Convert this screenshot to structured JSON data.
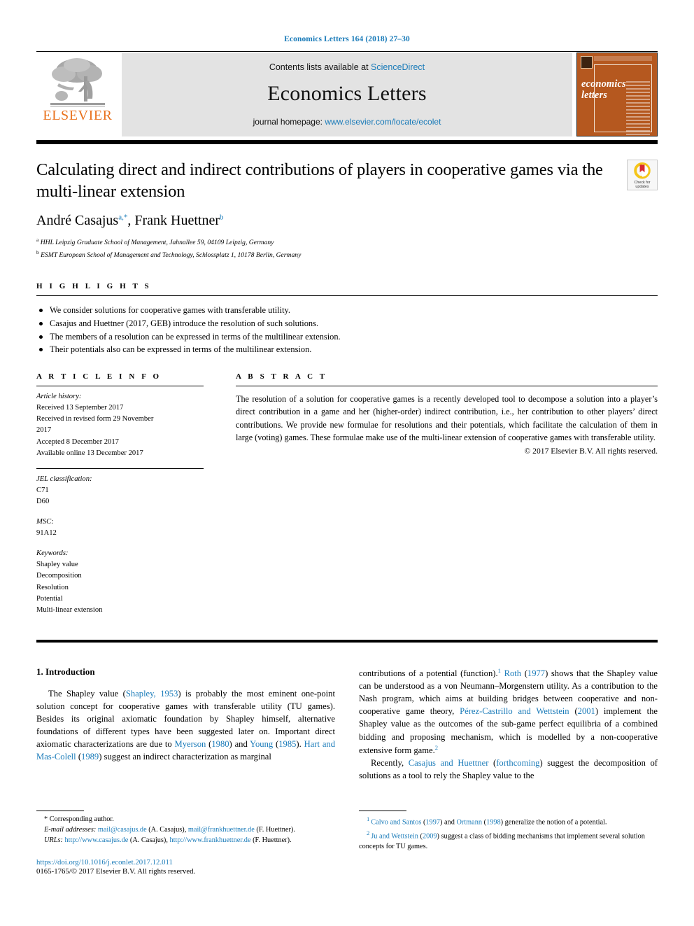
{
  "running_head": "Economics Letters 164 (2018) 27–30",
  "masthead": {
    "publisher_name": "ELSEVIER",
    "contents_prefix": "Contents lists available at ",
    "contents_link": "ScienceDirect",
    "journal_title": "Economics Letters",
    "homepage_prefix": "journal homepage: ",
    "homepage_link": "www.elsevier.com/locate/ecolet",
    "cover_title_line1": "economics",
    "cover_title_line2": "letters"
  },
  "article": {
    "title": "Calculating direct and indirect contributions of players in cooperative games via the multi-linear extension",
    "authors_plain": "André Casajus",
    "author1": "André Casajus",
    "author1_sup": "a,*",
    "author2": "Frank Huettner",
    "author2_sup": "b",
    "affiliation_a_marker": "a",
    "affiliation_a": "HHL Leipzig Graduate School of Management, Jahnallee 59, 04109 Leipzig, Germany",
    "affiliation_b_marker": "b",
    "affiliation_b": "ESMT European School of Management and Technology, Schlossplatz 1, 10178 Berlin, Germany"
  },
  "crossmark": {
    "line1": "Check for",
    "line2": "updates"
  },
  "highlights": {
    "heading": "H I G H L I G H T S",
    "items": [
      "We consider solutions for cooperative games with transferable utility.",
      "Casajus and Huettner (2017, GEB) introduce the resolution of such solutions.",
      "The members of a resolution can be expressed in terms of the multilinear extension.",
      "Their potentials also can be expressed in terms of the multilinear extension."
    ]
  },
  "article_info": {
    "heading": "A R T I C L E   I N F O",
    "history_label": "Article history:",
    "history_lines": [
      "Received 13 September 2017",
      "Received in revised form 29 November",
      "2017",
      "Accepted 8 December 2017",
      "Available online 13 December 2017"
    ],
    "jel_label": "JEL classification:",
    "jel_codes": [
      "C71",
      "D60"
    ],
    "msc_label": "MSC:",
    "msc_codes": [
      "91A12"
    ],
    "keywords_label": "Keywords:",
    "keywords": [
      "Shapley value",
      "Decomposition",
      "Resolution",
      "Potential",
      "Multi-linear extension"
    ]
  },
  "abstract": {
    "heading": "A B S T R A C T",
    "text": "The resolution of a solution for cooperative games is a recently developed tool to decompose a solution into a player’s direct contribution in a game and her (higher-order) indirect contribution, i.e., her contribution to other players’ direct contributions. We provide new formulae for resolutions and their potentials, which facilitate the calculation of them in large (voting) games. These formulae make use of the multi-linear extension of cooperative games with transferable utility.",
    "copyright": "© 2017 Elsevier B.V. All rights reserved."
  },
  "body": {
    "section_number_title": "1. Introduction",
    "left_para1_part1": "The Shapley value (",
    "left_cite1": "Shapley, 1953",
    "left_para1_part2": ") is probably the most eminent one-point solution concept for cooperative games with transferable utility (TU games). Besides its original axiomatic foundation by Shapley himself, alternative foundations of different types have been suggested later on. Important direct axiomatic characterizations are due to ",
    "left_cite2": "Myerson",
    "left_para1_part3": " (",
    "left_cite2_year": "1980",
    "left_para1_part4": ") and ",
    "left_cite3": "Young",
    "left_para1_part5": " (",
    "left_cite3_year": "1985",
    "left_para1_part6": "). ",
    "left_cite4": "Hart and Mas-Colell",
    "left_para1_part7": " (",
    "left_cite4_year": "1989",
    "left_para1_part8": ") suggest an indirect characterization as marginal",
    "right_para1_part1": "contributions of a potential (function).",
    "right_fn1": "1",
    "right_cite1": "Roth",
    "right_para1_part2": " (",
    "right_cite1_year": "1977",
    "right_para1_part3": ") shows that the Shapley value can be understood as a von Neumann–Morgenstern utility. As a contribution to the Nash program, which aims at building bridges between cooperative and non-cooperative game theory, ",
    "right_cite2": "Pérez-Castrillo and Wettstein",
    "right_para1_part4": " (",
    "right_cite2_year": "2001",
    "right_para1_part5": ") implement the Shapley value as the outcomes of the sub-game perfect equilibria of a combined bidding and proposing mechanism, which is modelled by a non-cooperative extensive form game.",
    "right_fn2": "2",
    "right_para2_part1": "Recently, ",
    "right_cite3": "Casajus and Huettner",
    "right_para2_part2": " (",
    "right_cite3_year": "forthcoming",
    "right_para2_part3": ") suggest the decomposition of solutions as a tool to rely the Shapley value to the"
  },
  "footnotes": {
    "corresponding_author": "* Corresponding author.",
    "email_label": "E-mail addresses:",
    "email1": "mail@casajus.de",
    "email1_owner": " (A. Casajus), ",
    "email2": "mail@frankhuettner.de",
    "email2_owner": " (F. Huettner).",
    "urls_label": "URLs:",
    "url1": "http://www.casajus.de",
    "url1_owner": " (A. Casajus), ",
    "url2": "http://www.frankhuettner.de",
    "url2_owner": " (F. Huettner).",
    "doi": "https://doi.org/10.1016/j.econlet.2017.12.011",
    "issn_line": "0165-1765/© 2017 Elsevier B.V. All rights reserved.",
    "note1_number": "1",
    "note1_cite1": "Calvo and Santos",
    "note1_mid1": " (",
    "note1_year1": "1997",
    "note1_mid2": ") and ",
    "note1_cite2": "Ortmann",
    "note1_mid3": " (",
    "note1_year2": "1998",
    "note1_tail": ") generalize the notion of a potential.",
    "note2_number": "2",
    "note2_cite1": "Ju and Wettstein",
    "note2_mid1": " (",
    "note2_year1": "2009",
    "note2_tail": ") suggest a class of bidding mechanisms that implement several solution concepts for TU games."
  },
  "colors": {
    "link": "#1a7bb9",
    "elsevier_orange": "#e9711c",
    "cover_brown": "#b5581f",
    "masthead_grey": "#e3e3e3"
  }
}
